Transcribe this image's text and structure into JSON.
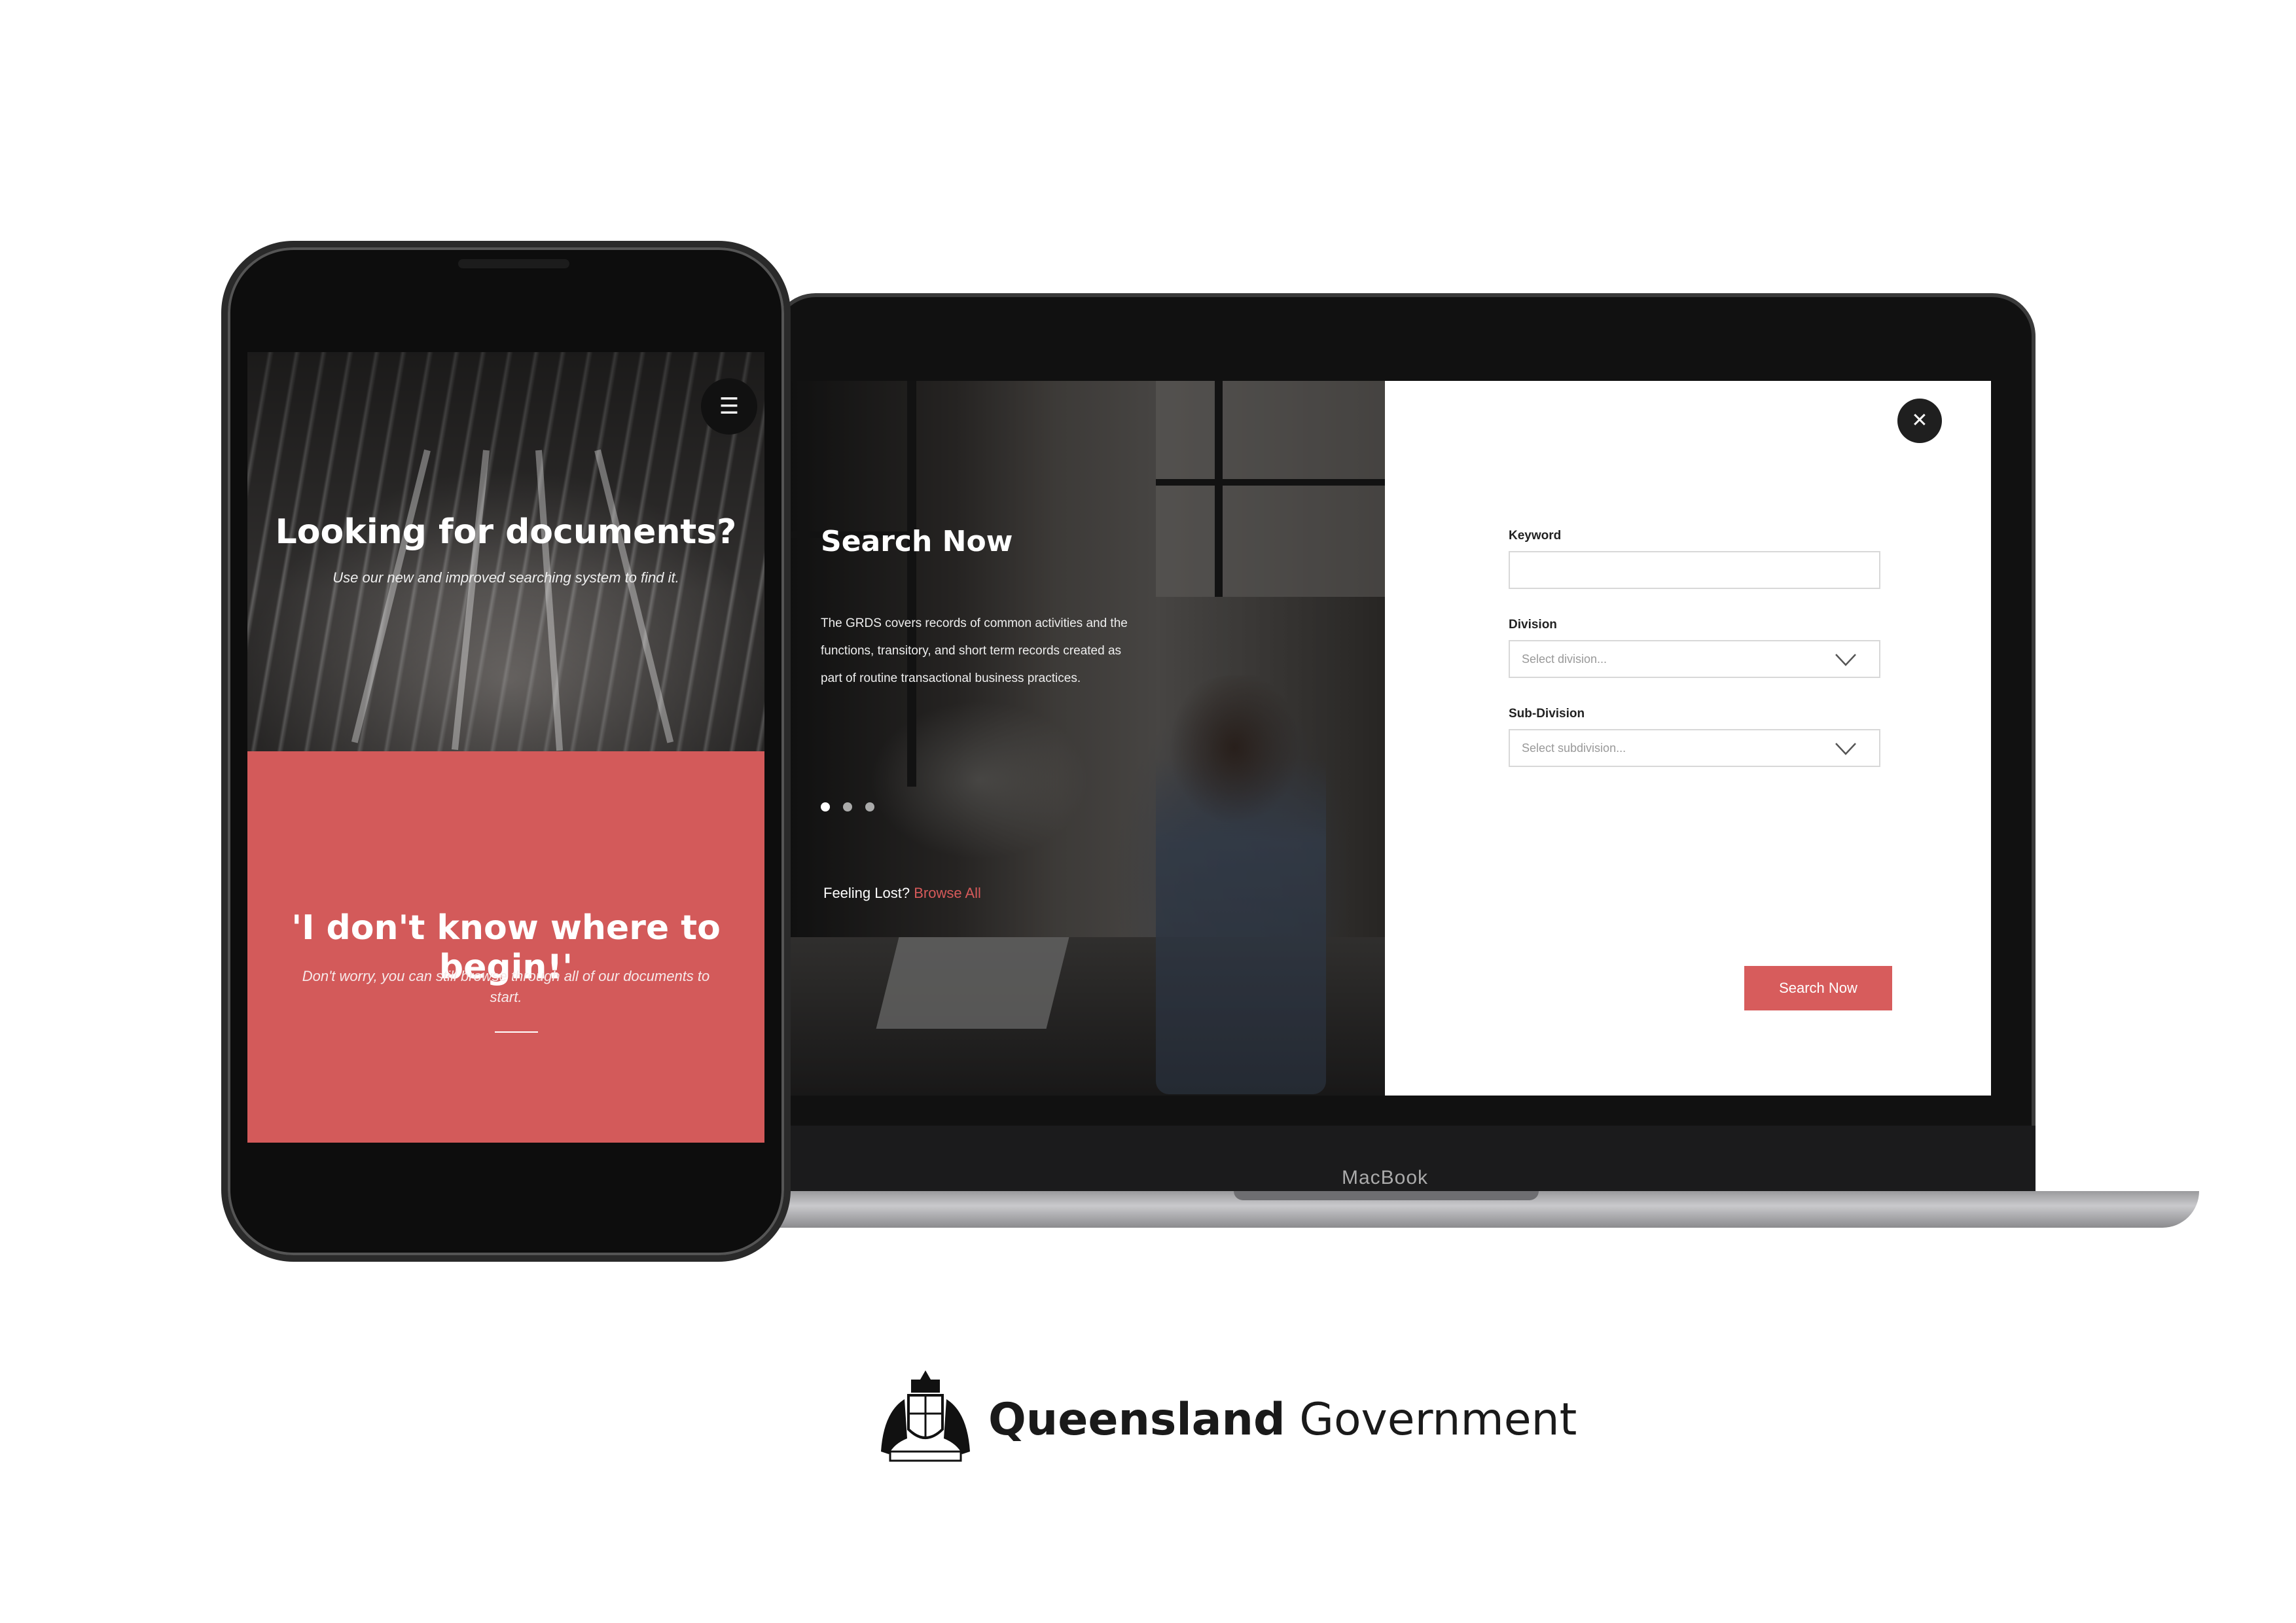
{
  "laptop": {
    "brand_label": "MacBook",
    "hero": {
      "title": "Search Now",
      "body": "The GRDS covers records of common activities and the functions, transitory, and short term records created as part of routine transactional business practices.",
      "carousel_dots": 3,
      "active_dot": 0,
      "lost_prefix": "Feeling Lost?",
      "browse_link": "Browse All"
    },
    "form": {
      "keyword_label": "Keyword",
      "keyword_value": "",
      "division_label": "Division",
      "division_placeholder": "Select division...",
      "subdivision_label": "Sub-Division",
      "subdivision_placeholder": "Select subdivision...",
      "submit_label": "Search Now",
      "close_icon": "close-icon"
    }
  },
  "phone": {
    "menu_icon": "hamburger-menu-icon",
    "hero_title": "Looking for documents?",
    "hero_subtitle": "Use our new and improved searching system to find it.",
    "quote": "'I don't know where to begin!'",
    "quote_subtitle": "Don't worry, you can still browse through all of our documents to start."
  },
  "logo": {
    "name_bold": "Queensland",
    "name_regular": "Government"
  },
  "colors": {
    "accent": "#d35a5a",
    "dark": "#1f1f1f"
  }
}
